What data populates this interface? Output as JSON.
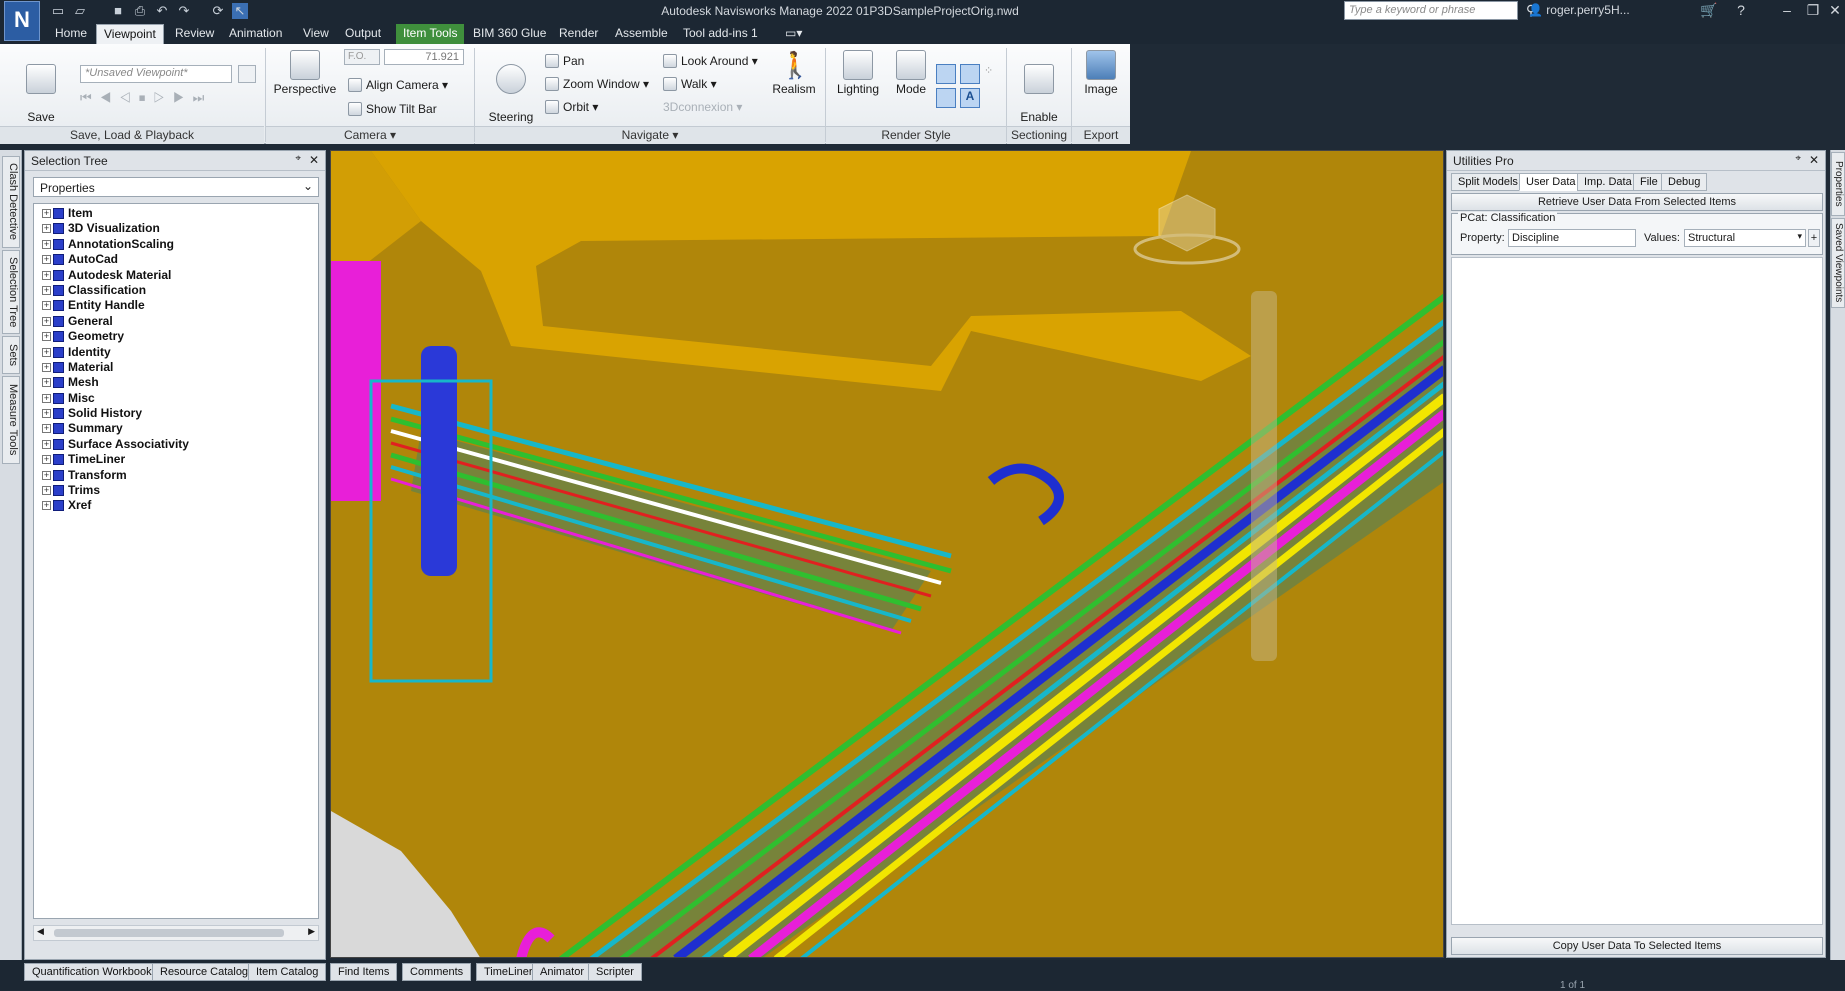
{
  "app": {
    "logo_letter": "N",
    "window_title": "Autodesk Navisworks Manage 2022    01P3DSampleProjectOrig.nwd",
    "search_placeholder": "Type a keyword or phrase",
    "user": "roger.perry5H...",
    "help_icon": "?"
  },
  "ribbon_tabs": [
    {
      "label": "Home"
    },
    {
      "label": "Viewpoint"
    },
    {
      "label": "Review"
    },
    {
      "label": "Animation"
    },
    {
      "label": "View"
    },
    {
      "label": "Output"
    },
    {
      "label": "Item Tools"
    },
    {
      "label": "BIM 360 Glue"
    },
    {
      "label": "Render"
    },
    {
      "label": "Assemble"
    },
    {
      "label": "Tool add-ins 1"
    }
  ],
  "ribbon": {
    "save_load": {
      "panel_title": "Save, Load & Playback",
      "save_viewpoint": "Save\nViewpoint",
      "viewpoint_combo": "*Unsaved Viewpoint*"
    },
    "camera": {
      "panel_title": "Camera",
      "perspective": "Perspective",
      "fov_label": "F.O.",
      "fov_value": "71.921",
      "align_camera": "Align Camera",
      "show_tilt_bar": "Show Tilt Bar"
    },
    "navigate": {
      "panel_title": "Navigate",
      "steering_wheels": "Steering\nWheels",
      "pan": "Pan",
      "zoom_window": "Zoom Window",
      "orbit": "Orbit",
      "look_around": "Look Around",
      "walk": "Walk",
      "connexion": "3Dconnexion",
      "realism": "Realism"
    },
    "render_style": {
      "panel_title": "Render Style",
      "lighting": "Lighting",
      "mode": "Mode"
    },
    "sectioning": {
      "panel_title": "Sectioning",
      "enable_sectioning": "Enable\nSectioning"
    },
    "export": {
      "panel_title": "Export",
      "image": "Image"
    }
  },
  "left_tabs": [
    "Clash Detective",
    "Selection Tree",
    "Sets",
    "Measure Tools"
  ],
  "selection_tree": {
    "title": "Selection Tree",
    "mode": "Properties",
    "items": [
      "Item",
      "3D Visualization",
      "AnnotationScaling",
      "AutoCad",
      "Autodesk Material",
      "Classification",
      "Entity Handle",
      "General",
      "Geometry",
      "Identity",
      "Material",
      "Mesh",
      "Misc",
      "Solid History",
      "Summary",
      "Surface Associativity",
      "TimeLiner",
      "Transform",
      "Trims",
      "Xref"
    ]
  },
  "utilities": {
    "title": "Utilities Pro",
    "tabs": [
      "Split Models",
      "User Data",
      "Imp. Data",
      "File",
      "Debug"
    ],
    "retrieve_button": "Retrieve User Data From Selected Items",
    "group_title": "PCat: Classification",
    "property_label": "Property:",
    "property_value": "Discipline",
    "values_label": "Values:",
    "values_value": "Structural",
    "copy_button": "Copy User Data To Selected Items"
  },
  "right_tabs": [
    "Properties",
    "Saved Viewpoints"
  ],
  "bottom_tabs": [
    "Quantification Workbook",
    "Resource Catalog",
    "Item Catalog",
    "Find Items",
    "Comments",
    "TimeLiner",
    "Animator",
    "Scripter"
  ],
  "status": {
    "page": "1 of 1"
  },
  "colors": {
    "ground": "#b0860a",
    "pad": "#e0a800",
    "structure": "#17b7c9",
    "pipe_green": "#2fbf2f",
    "pipe_blue": "#1e2fd0",
    "pipe_yellow": "#f2e600",
    "pipe_magenta": "#e81fd8"
  }
}
